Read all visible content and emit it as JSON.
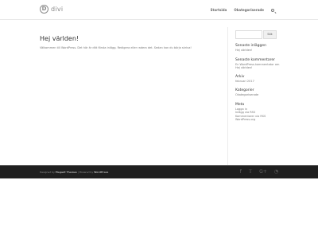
{
  "header": {
    "logo_mark": "D",
    "logo_text": "divi",
    "nav": [
      "Startsida",
      "Okategoriserade"
    ]
  },
  "main": {
    "title": "Hej världen!",
    "excerpt": "Välkommen till WordPress. Det här är ditt första inlägg. Redigera eller radera det. Sedan kan du börja skriva!"
  },
  "sidebar": {
    "search_button": "Sök",
    "widgets": [
      {
        "title": "Senaste inläggen",
        "items": [
          "Hej världen!"
        ]
      },
      {
        "title": "Senaste kommentarer",
        "items": [
          "En WordPress-kommentator om",
          "Hej världen!"
        ]
      },
      {
        "title": "Arkiv",
        "items": [
          "februari 2017"
        ]
      },
      {
        "title": "Kategorier",
        "items": [
          "Okategoriserade"
        ]
      },
      {
        "title": "Meta",
        "items": [
          "Logga in",
          "Inlägg via RSS",
          "Kommentarer via RSS",
          "WordPress.org"
        ]
      }
    ]
  },
  "footer": {
    "credit_prefix": "Designed by",
    "credit_designer": "Elegant Themes",
    "credit_mid": "| Powered by",
    "credit_platform": "WordPress",
    "social": [
      "f",
      "t",
      "G+",
      "rss"
    ]
  }
}
